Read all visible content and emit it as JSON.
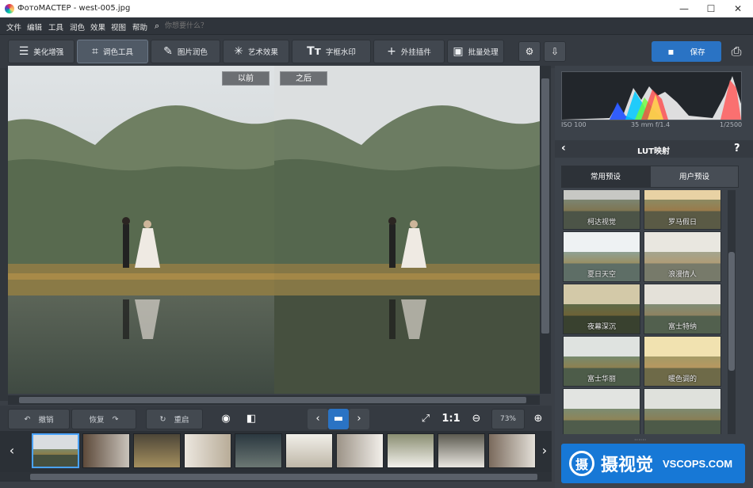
{
  "window": {
    "title": "ФотоМАСТЕР - west-005.jpg",
    "minimize": "—",
    "maximize": "☐",
    "close": "✕"
  },
  "menu": [
    "文件",
    "编辑",
    "工具",
    "润色",
    "效果",
    "视图",
    "帮助"
  ],
  "search": {
    "placeholder": "你想要什么？"
  },
  "toolbar": {
    "tabs": [
      {
        "label": "美化增强",
        "icon": "sliders-icon"
      },
      {
        "label": "调色工具",
        "icon": "crop-icon"
      },
      {
        "label": "图片润色",
        "icon": "brush-icon"
      },
      {
        "label": "艺术效果",
        "icon": "magic-wand-icon"
      },
      {
        "label": "字框水印",
        "icon": "text-icon"
      },
      {
        "label": "外挂插件",
        "icon": "plus-icon"
      }
    ],
    "batch_label": "批量处理",
    "save_label": "保存"
  },
  "canvas": {
    "before_label": "以前",
    "after_label": "之后"
  },
  "bottombar": {
    "undo_label": "撤销",
    "redo_label": "恢复",
    "reset_label": "重启",
    "zoom_label": "1:1",
    "zoom_value": "73%"
  },
  "histogram": {
    "iso": "ISO 100",
    "lens": "35 mm f/1.4",
    "shutter": "1/2500"
  },
  "panel": {
    "title": "LUT映射",
    "help": "?",
    "tabs": [
      "常用预设",
      "用户预设"
    ],
    "presets": [
      "柯达视觉",
      "罗马假日",
      "夏日天空",
      "浪漫情人",
      "夜幕深沉",
      "富士特纳",
      "富士华丽",
      "暖色调的"
    ],
    "partial_label": "······"
  },
  "watermark": {
    "glyph": "摄",
    "brand": "摄视觉",
    "site": "VSCOPS.COM"
  },
  "colors": {
    "accent": "#2a73c4",
    "selection": "#4aa3ff",
    "watermark": "#1778d6"
  }
}
